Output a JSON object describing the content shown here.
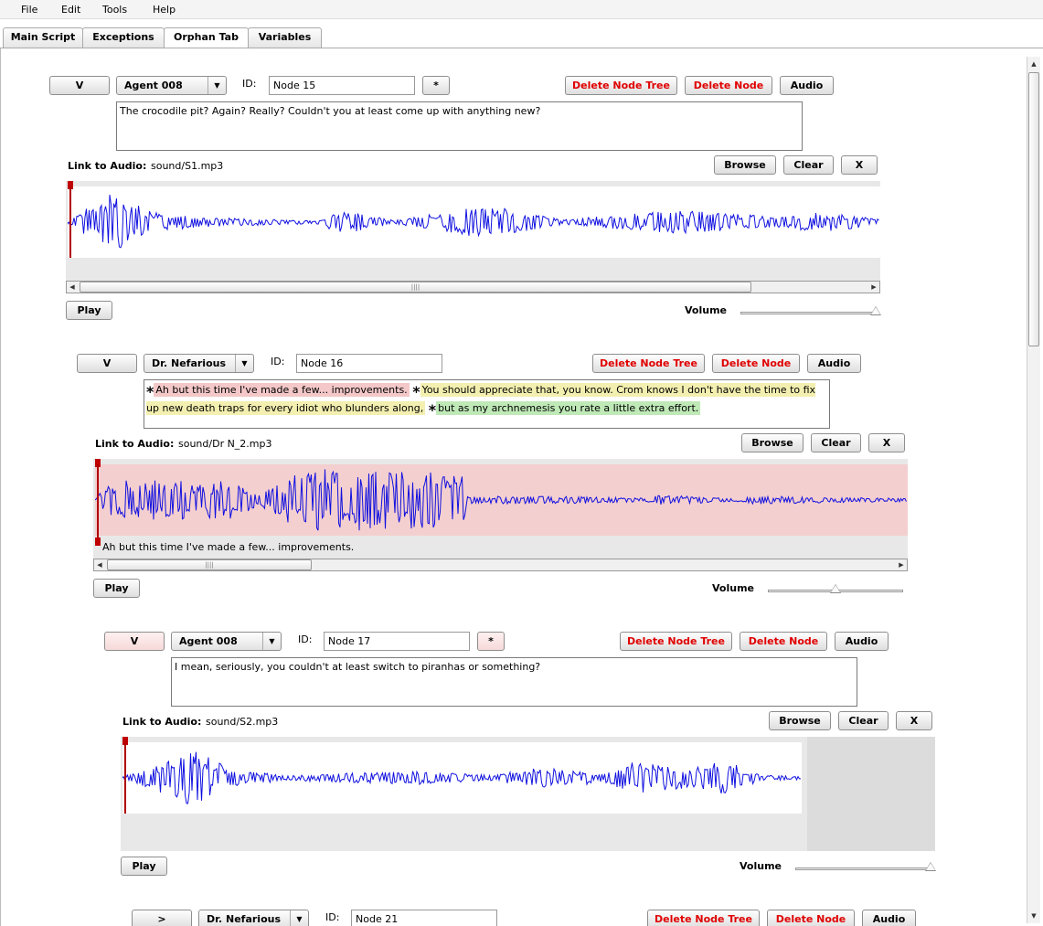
{
  "menu": [
    "File",
    "Edit",
    "Tools",
    "Help"
  ],
  "tabs": [
    {
      "label": "Main Script",
      "active": false
    },
    {
      "label": "Exceptions",
      "active": false
    },
    {
      "label": "Orphan Tab",
      "active": true
    },
    {
      "label": "Variables",
      "active": false
    }
  ],
  "labels": {
    "v": "V",
    "id": "ID:",
    "star": "*",
    "delete_tree": "Delete Node Tree",
    "delete_node": "Delete Node",
    "audio": "Audio",
    "link_audio": "Link to Audio:",
    "browse": "Browse",
    "clear": "Clear",
    "x": "X",
    "play": "Play",
    "volume": "Volume",
    "expand": ">",
    "combo_arrow": "▼",
    "scroll_left": "◀",
    "scroll_right": "▶",
    "scroll_up": "▲",
    "scroll_down": "▼",
    "grip": "||||"
  },
  "nodes": [
    {
      "speaker": "Agent 008",
      "id": "Node 15",
      "text": "The crocodile pit? Again? Really? Couldn't you at least come up with anything new?",
      "audio_path": "sound/S1.mp3",
      "volume": 1.0
    },
    {
      "speaker": "Dr. Nefarious",
      "id": "Node 16",
      "segments": [
        {
          "text": "Ah but this time I've made a few... improvements.",
          "color": "#f4c8c8"
        },
        {
          "text": "You should appreciate that, you know. Crom knows I don't have the time to fix up new death traps for every idiot who blunders along,",
          "color": "#f3efb0"
        },
        {
          "text": "but as my archnemesis you rate a little extra effort.",
          "color": "#bfe9b7"
        }
      ],
      "audio_path": "sound/Dr N_2.mp3",
      "selection_caption": "Ah but this time I've made a few... improvements.",
      "volume": 0.5
    },
    {
      "speaker": "Agent 008",
      "id": "Node 17",
      "text": "I mean, seriously, you couldn't at least switch to piranhas or something?",
      "audio_path": "sound/S2.mp3",
      "volume": 1.0
    },
    {
      "speaker": "Dr. Nefarious",
      "id": "Node 21"
    }
  ]
}
